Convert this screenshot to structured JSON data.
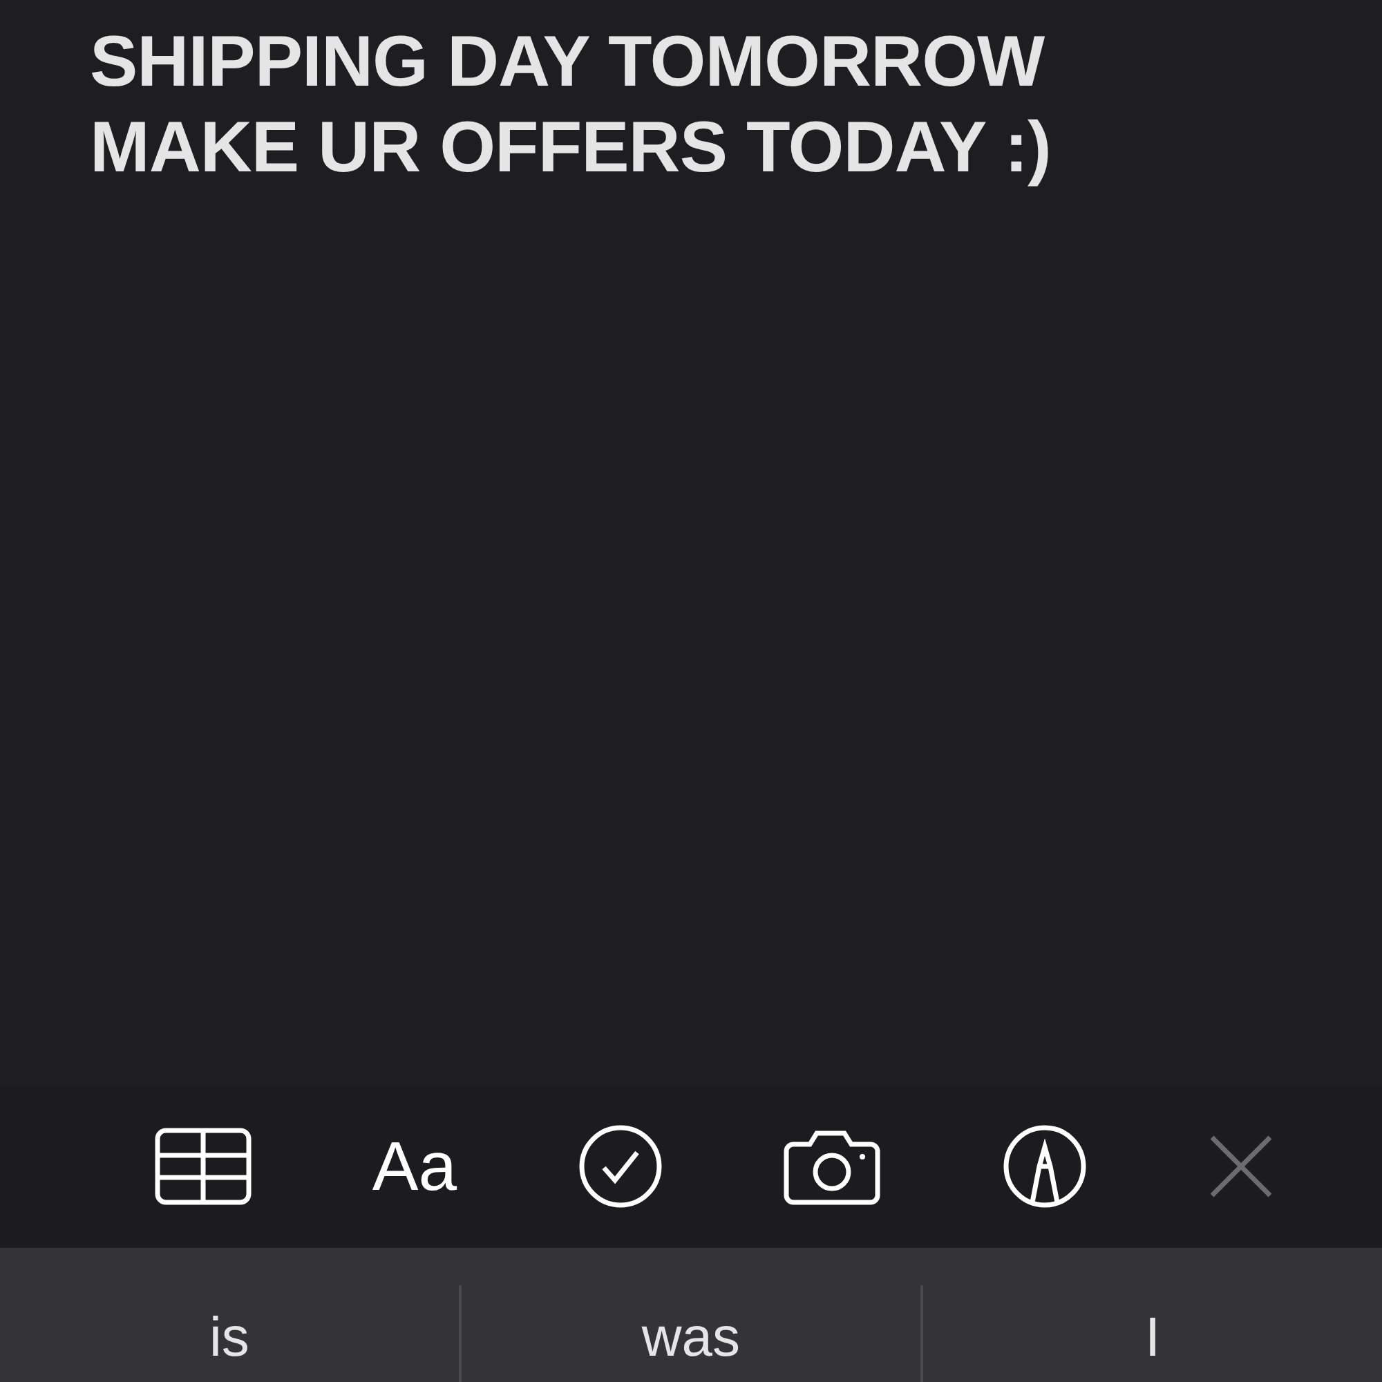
{
  "note": {
    "lines": [
      "SHIPPING DAY TOMORROW",
      "MAKE UR OFFERS TODAY :)"
    ]
  },
  "toolbar": [
    {
      "kind": "table",
      "disabled": false
    },
    {
      "kind": "format",
      "label": "Aa",
      "disabled": false
    },
    {
      "kind": "checklist",
      "disabled": false
    },
    {
      "kind": "camera",
      "disabled": false
    },
    {
      "kind": "markup",
      "disabled": false
    },
    {
      "kind": "close",
      "disabled": true
    }
  ],
  "suggestions": [
    "is",
    "was",
    "I"
  ]
}
